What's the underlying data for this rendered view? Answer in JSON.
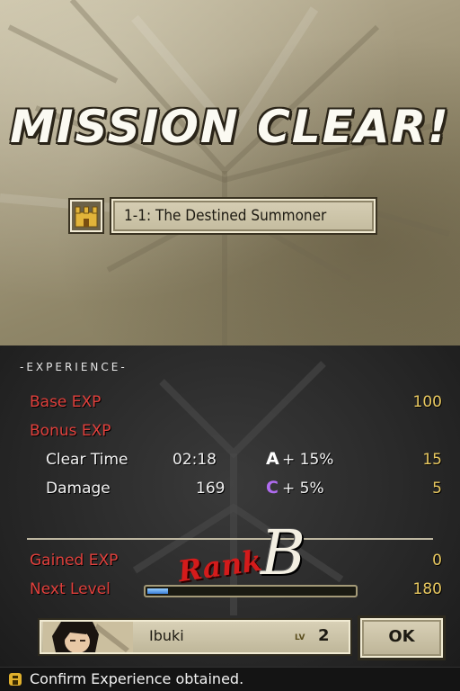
{
  "top": {
    "title": "MISSION CLEAR!",
    "mission": {
      "icon": "castle-icon",
      "name": "1-1: The Destined Summoner"
    }
  },
  "experience": {
    "section_label": "-EXPERIENCE-",
    "base_exp": {
      "label": "Base EXP",
      "value": "100"
    },
    "bonus_exp": {
      "label": "Bonus EXP"
    },
    "clear_time": {
      "label": "Clear Time",
      "value": "02:18",
      "grade": "A",
      "bonus_pct": "+ 15%",
      "exp": "15"
    },
    "damage": {
      "label": "Damage",
      "value": "169",
      "grade": "C",
      "bonus_pct": "+ 5%",
      "exp": "5"
    },
    "rank": {
      "word": "Rank",
      "letter": "B"
    },
    "gained_exp": {
      "label": "Gained EXP",
      "value": "0"
    },
    "next_level": {
      "label": "Next Level",
      "value": "180",
      "progress": 0.1
    }
  },
  "character": {
    "name": "Ibuki",
    "level_label": "LV",
    "level": "2",
    "icon": "portrait-avatar"
  },
  "ok_button": {
    "label": "OK"
  },
  "help": {
    "icon": "help-icon",
    "text": "Confirm Experience obtained."
  },
  "colors": {
    "label_red": "#e0403c",
    "value_gold": "#e8c860",
    "grade_c": "#b06cf0",
    "rank_red": "#d41b1b"
  }
}
